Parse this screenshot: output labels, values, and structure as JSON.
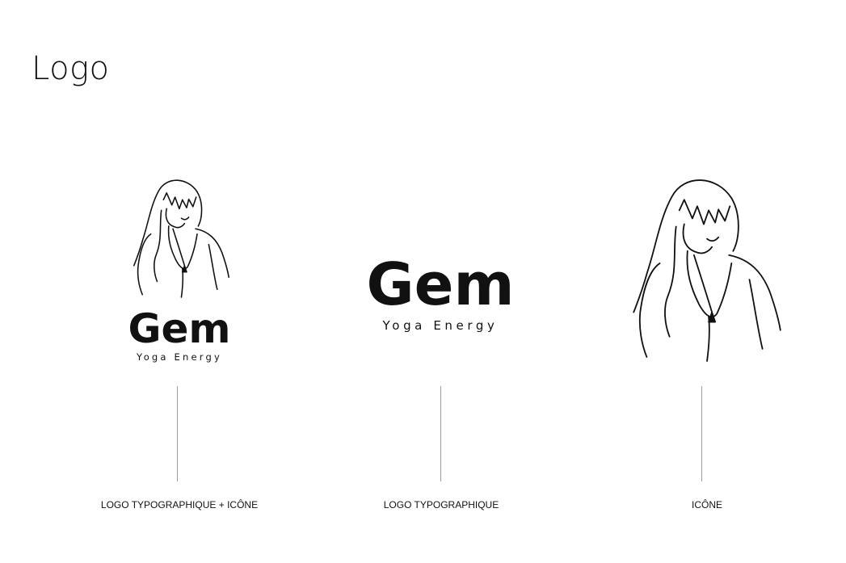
{
  "page": {
    "title": "Logo"
  },
  "brand": {
    "name": "Gem",
    "tagline": "Yoga Energy",
    "ink_color": "#111111",
    "icon": "woman-line-art-icon"
  },
  "variants": [
    {
      "caption": "LOGO TYPOGRAPHIQUE + ICÔNE"
    },
    {
      "caption": "LOGO TYPOGRAPHIQUE"
    },
    {
      "caption": "ICÔNE"
    }
  ]
}
